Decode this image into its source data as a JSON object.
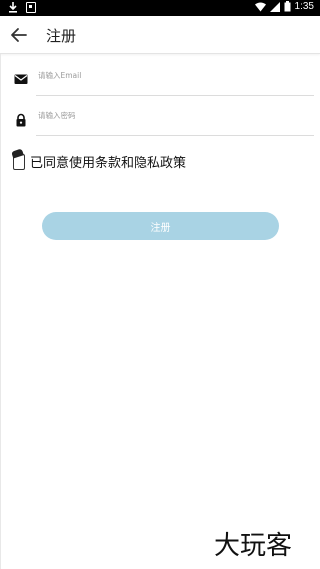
{
  "status_bar": {
    "time": "1:35",
    "icons": [
      "download-icon",
      "notification-box-icon",
      "wifi-icon",
      "signal-icon",
      "battery-icon"
    ],
    "background": "#000000"
  },
  "app_bar": {
    "title": "注册",
    "back_icon": "arrow-left-icon"
  },
  "form": {
    "email": {
      "icon": "envelope-icon",
      "placeholder": "请输入Email",
      "value": ""
    },
    "password": {
      "icon": "lock-icon",
      "placeholder": "请输入密码",
      "value": ""
    },
    "agree_text": "已同意使用条款和隐私政策",
    "submit_label": "注册",
    "submit_color": "#a9d3e4"
  },
  "watermark": {
    "text": "大玩客"
  }
}
